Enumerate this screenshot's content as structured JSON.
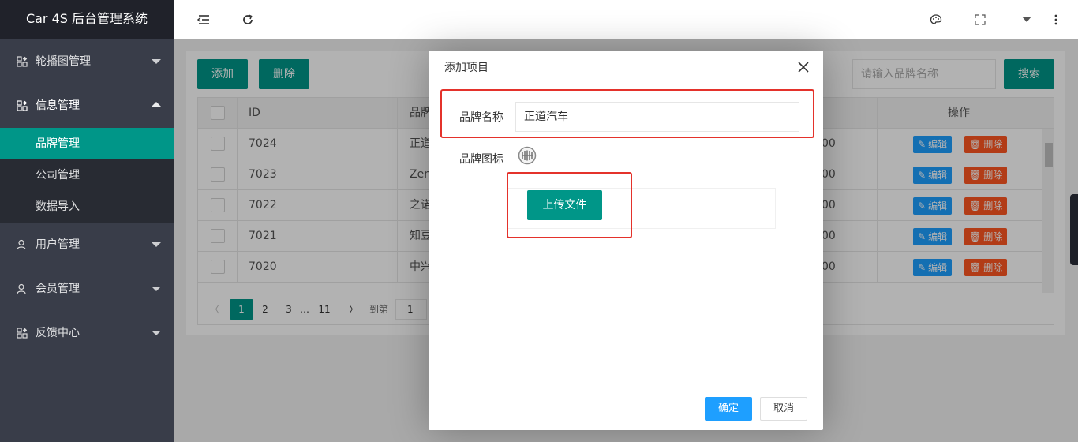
{
  "app": {
    "title": "Car 4S 后台管理系统"
  },
  "sidebar": {
    "items": [
      {
        "label": "轮播图管理",
        "icon": "grid-icon"
      },
      {
        "label": "信息管理",
        "icon": "grid-icon",
        "children": [
          "品牌管理",
          "公司管理",
          "数据导入"
        ]
      },
      {
        "label": "用户管理",
        "icon": "user-icon"
      },
      {
        "label": "会员管理",
        "icon": "user-icon"
      },
      {
        "label": "反馈中心",
        "icon": "grid-icon"
      }
    ]
  },
  "toolbar": {
    "add_label": "添加",
    "delete_label": "删除",
    "search_placeholder": "请输入品牌名称",
    "search_label": "搜索"
  },
  "table": {
    "headers": {
      "id": "ID",
      "name": "品牌",
      "action": "操作"
    },
    "rows": [
      {
        "id": "7024",
        "name": "正道",
        "time": "00"
      },
      {
        "id": "7023",
        "name": "Zen",
        "time": "00"
      },
      {
        "id": "7022",
        "name": "之诺",
        "time": "00"
      },
      {
        "id": "7021",
        "name": "知豆",
        "time": "00"
      },
      {
        "id": "7020",
        "name": "中兴",
        "time": "00"
      }
    ],
    "edit_label": "编辑",
    "delete_label": "删除"
  },
  "pagination": {
    "pages": [
      "1",
      "2",
      "3",
      "…",
      "11"
    ],
    "goto_label": "到第",
    "goto_value": "1"
  },
  "modal": {
    "title": "添加项目",
    "brand_name_label": "品牌名称",
    "brand_name_value": "正道汽车",
    "brand_icon_label": "品牌图标",
    "upload_label": "上传文件",
    "confirm_label": "确定",
    "cancel_label": "取消"
  },
  "colors": {
    "primary": "#009688",
    "sidebar": "#393d49",
    "edit": "#1e9fff",
    "danger": "#ff5722",
    "highlight": "#e4322b"
  }
}
